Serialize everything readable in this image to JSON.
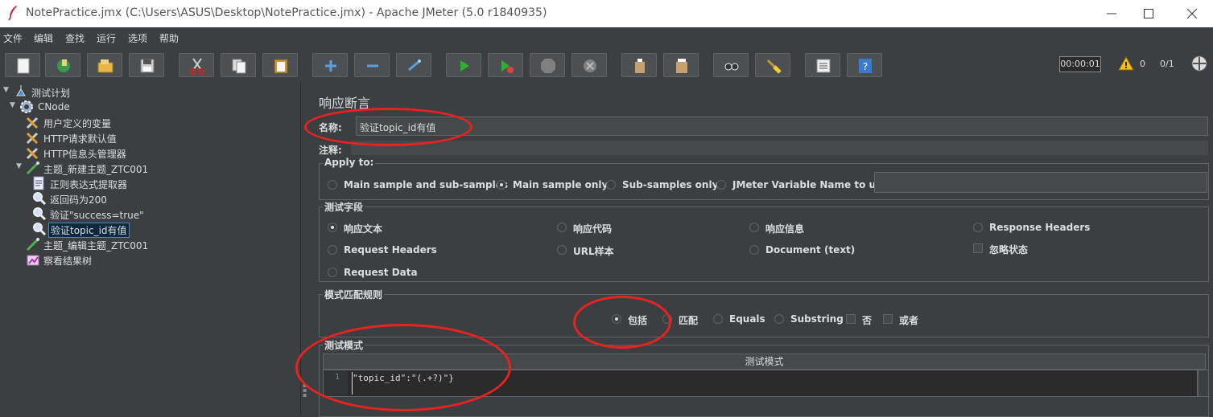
{
  "window": {
    "title": "NotePractice.jmx (C:\\Users\\ASUS\\Desktop\\NotePractice.jmx) - Apache JMeter (5.0 r1840935)",
    "minimize_icon": "minimize-icon",
    "maximize_icon": "maximize-icon",
    "close_icon": "close-icon"
  },
  "menu": [
    "文件",
    "编辑",
    "查找",
    "运行",
    "选项",
    "帮助"
  ],
  "toolbar": {
    "buttons": [
      "new-icon",
      "templates-icon",
      "open-icon",
      "save-icon",
      "cut-icon",
      "copy-icon",
      "paste-icon",
      "expand-icon",
      "collapse-icon",
      "toggle-icon",
      "start-icon",
      "start-no-pause-icon",
      "stop-icon",
      "shutdown-icon",
      "clear-icon",
      "clear-all-icon",
      "search-icon",
      "reset-search-icon",
      "function-helper-icon",
      "help-icon"
    ],
    "timer": "00:00:01",
    "warning_count": "0",
    "threads": "0/1"
  },
  "tree": {
    "items": [
      {
        "label": "测试计划",
        "icon": "test-plan-icon"
      },
      {
        "label": "CNode",
        "icon": "thread-group-icon"
      },
      {
        "label": "用户定义的变量",
        "icon": "config-element-icon"
      },
      {
        "label": "HTTP请求默认值",
        "icon": "config-element-icon"
      },
      {
        "label": "HTTP信息头管理器",
        "icon": "config-element-icon"
      },
      {
        "label": "主题_新建主题_ZTC001",
        "icon": "sampler-icon"
      },
      {
        "label": "正则表达式提取器",
        "icon": "post-processor-icon"
      },
      {
        "label": "返回码为200",
        "icon": "assertion-icon"
      },
      {
        "label": "验证\"success=true\"",
        "icon": "assertion-icon"
      },
      {
        "label": "验证topic_id有值",
        "icon": "assertion-icon"
      },
      {
        "label": "主题_编辑主题_ZTC001",
        "icon": "sampler-icon"
      },
      {
        "label": "察看结果树",
        "icon": "listener-icon"
      }
    ]
  },
  "panel": {
    "title": "响应断言",
    "name_label": "名称:",
    "name_value": "验证topic_id有值",
    "comment_label": "注释:",
    "apply_to": {
      "title": "Apply to:",
      "options": [
        "Main sample and sub-samples",
        "Main sample only",
        "Sub-samples only",
        "JMeter Variable Name to use"
      ],
      "selected": "Main sample only"
    },
    "test_field": {
      "title": "测试字段",
      "options": [
        "响应文本",
        "响应代码",
        "响应信息",
        "Response Headers",
        "Request Headers",
        "URL样本",
        "Document (text)",
        "Request Data"
      ],
      "ignore_status": "忽略状态",
      "selected": "响应文本"
    },
    "pattern_rules": {
      "title": "模式匹配规则",
      "options": [
        "包括",
        "匹配",
        "Equals",
        "Substring"
      ],
      "not_label": "否",
      "or_label": "或者",
      "selected": "包括"
    },
    "patterns": {
      "title": "测试模式",
      "column_header": "测试模式",
      "line_number": "1",
      "code": "\"topic_id\":\"(.+?)\"}"
    }
  },
  "colors": {
    "background": "#3c3f41",
    "annotation": "#e8221e",
    "selection": "#0d293e"
  }
}
